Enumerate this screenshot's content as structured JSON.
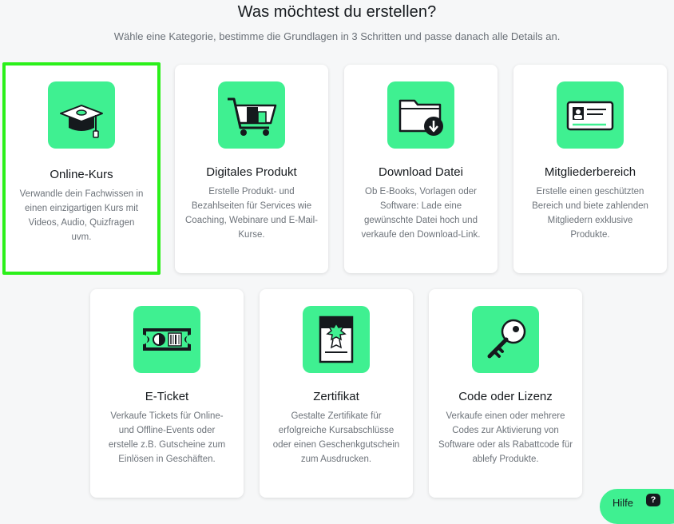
{
  "header": {
    "title": "Was möchtest du erstellen?",
    "subtitle": "Wähle eine Kategorie, bestimme die Grundlagen in 3 Schritten und passe danach alle Details an."
  },
  "colors": {
    "accent": "#3ff091",
    "selected_border": "#2bf01a"
  },
  "cards": [
    {
      "icon": "graduation-cap-icon",
      "title": "Online-Kurs",
      "description": "Verwandle dein Fachwissen in einen einzigartigen Kurs mit Videos, Audio, Quizfragen uvm."
    },
    {
      "icon": "shopping-cart-icon",
      "title": "Digitales Produkt",
      "description": "Erstelle Produkt- und Bezahlseiten für Services wie Coaching, Webinare und E-Mail-Kurse."
    },
    {
      "icon": "folder-download-icon",
      "title": "Download Datei",
      "description": "Ob E-Books, Vorlagen oder Software: Lade eine gewünschte Datei hoch und verkaufe den Download-Link."
    },
    {
      "icon": "member-card-icon",
      "title": "Mitgliederbereich",
      "description": "Erstelle einen geschützten Bereich und biete zahlenden Mitgliedern exklusive Produkte."
    },
    {
      "icon": "ticket-icon",
      "title": "E-Ticket",
      "description": "Verkaufe Tickets für Online- und Offline-Events oder erstelle z.B. Gutscheine zum Einlösen in Geschäften."
    },
    {
      "icon": "certificate-icon",
      "title": "Zertifikat",
      "description": "Gestalte Zertifikate für erfolgreiche Kursabschlüsse oder einen Geschenkgutschein zum Ausdrucken."
    },
    {
      "icon": "key-icon",
      "title": "Code oder Lizenz",
      "description": "Verkaufe einen oder mehrere Codes zur Aktivierung von Software oder als Rabattcode für ablefy Produkte."
    }
  ],
  "help": {
    "label": "Hilfe",
    "icon": "help-chat-icon",
    "icon_text": "?"
  }
}
